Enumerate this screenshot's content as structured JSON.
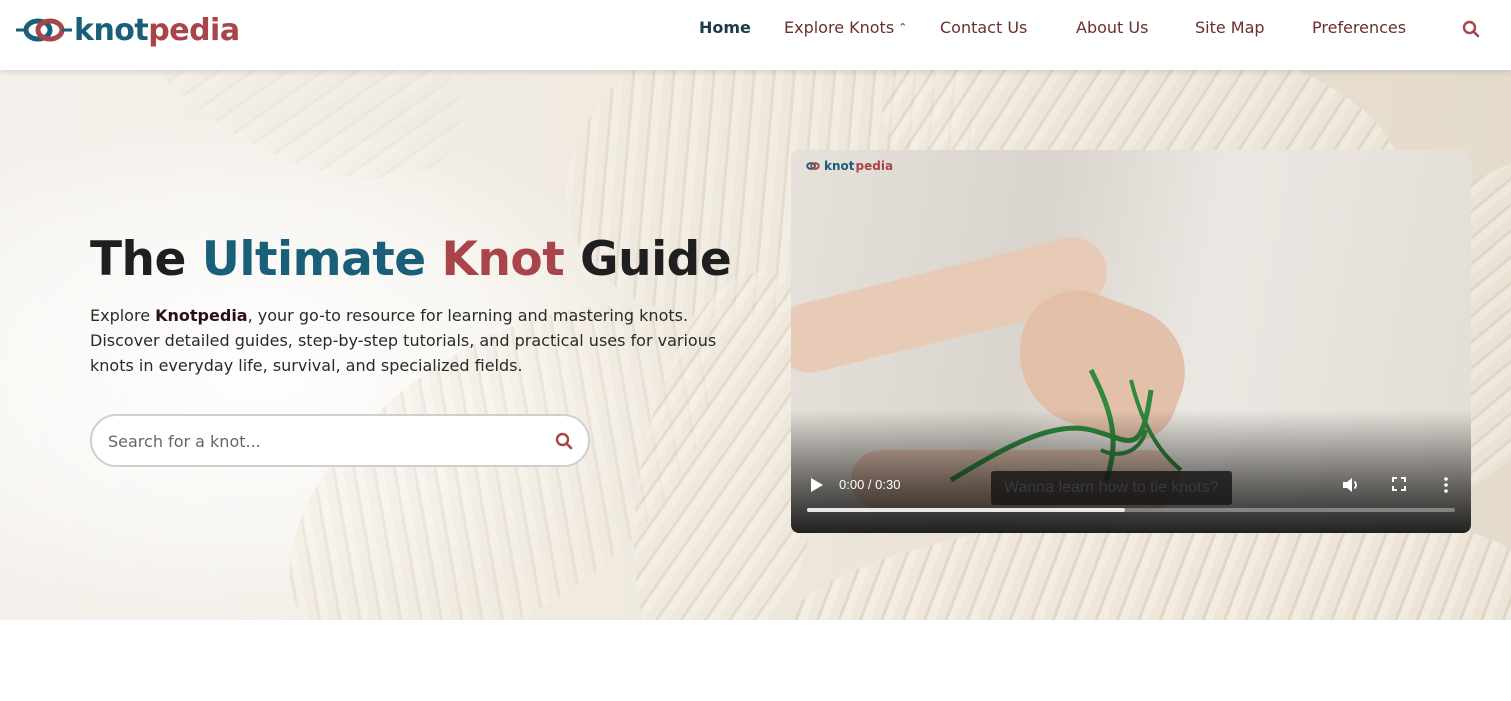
{
  "brand": {
    "name_part1": "knot",
    "name_part2": "pedia",
    "primary_color": "#1a5f7a",
    "accent_color": "#a8444a"
  },
  "nav": {
    "items": [
      {
        "label": "Home",
        "active": true
      },
      {
        "label": "Explore Knots",
        "has_dropdown": true
      },
      {
        "label": "Contact Us"
      },
      {
        "label": "About Us"
      },
      {
        "label": "Site Map"
      },
      {
        "label": "Preferences"
      }
    ],
    "search_icon": "search-icon",
    "dropdown_icon": "chevron-up-icon"
  },
  "hero": {
    "title_part1": "The ",
    "title_part2": "Ultimate",
    "title_part3": " ",
    "title_part4": "Knot",
    "title_part5": " Guide",
    "desc_before": "Explore ",
    "desc_bold": "Knotpedia",
    "desc_after": ", your go-to resource for learning and mastering knots. Discover detailed guides, step-by-step tutorials, and practical uses for various knots in everyday life, survival, and specialized fields.",
    "search": {
      "placeholder": "Search for a knot...",
      "value": "",
      "icon": "search-icon"
    }
  },
  "video": {
    "watermark_part1": "knot",
    "watermark_part2": "pedia",
    "time": "0:00 / 0:30",
    "caption": "Wanna learn how to tie knots?",
    "buffered_fraction": 0.49,
    "controls": [
      "play-icon",
      "volume-icon",
      "fullscreen-icon",
      "more-options-icon"
    ]
  }
}
